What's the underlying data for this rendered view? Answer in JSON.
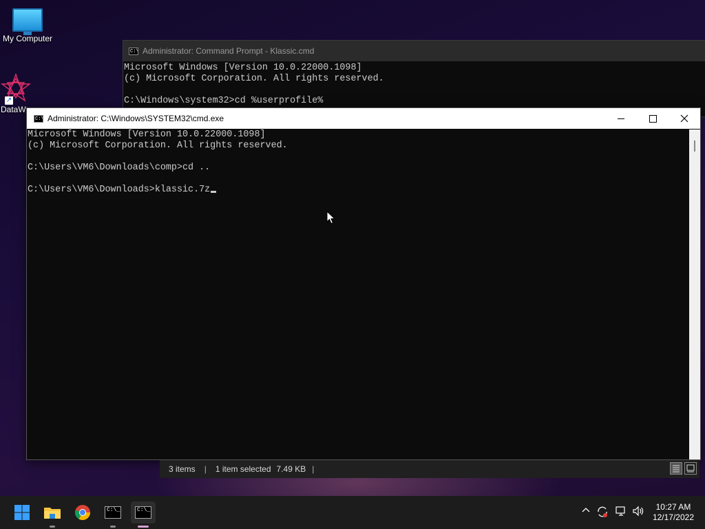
{
  "desktop": {
    "icons": [
      {
        "label": "My Computer"
      },
      {
        "label": "DataW"
      }
    ]
  },
  "back_window": {
    "title": "Administrator: Command Prompt - Klassic.cmd",
    "lines": [
      "Microsoft Windows [Version 10.0.22000.1098]",
      "(c) Microsoft Corporation. All rights reserved.",
      "",
      "C:\\Windows\\system32>cd %userprofile%"
    ]
  },
  "front_window": {
    "title": "Administrator: C:\\Windows\\SYSTEM32\\cmd.exe",
    "lines": [
      "Microsoft Windows [Version 10.0.22000.1098]",
      "(c) Microsoft Corporation. All rights reserved.",
      "",
      "C:\\Users\\VM6\\Downloads\\comp>cd ..",
      ""
    ],
    "prompt": "C:\\Users\\VM6\\Downloads>",
    "typed": "klassic.7z"
  },
  "status_bar": {
    "items_count": "3 items",
    "selection": "1 item selected",
    "size": "7.49 KB",
    "separator": "|"
  },
  "taskbar": {
    "apps": [
      "start-icon",
      "file-explorer-icon",
      "chrome-icon",
      "cmd-icon",
      "cmd-icon"
    ],
    "clock_time": "10:27 AM",
    "clock_date": "12/17/2022"
  },
  "colors": {
    "console_bg": "#0c0c0c",
    "console_fg": "#cccccc",
    "taskbar_bg": "#1c1c1c",
    "accent": "#0078d4"
  }
}
